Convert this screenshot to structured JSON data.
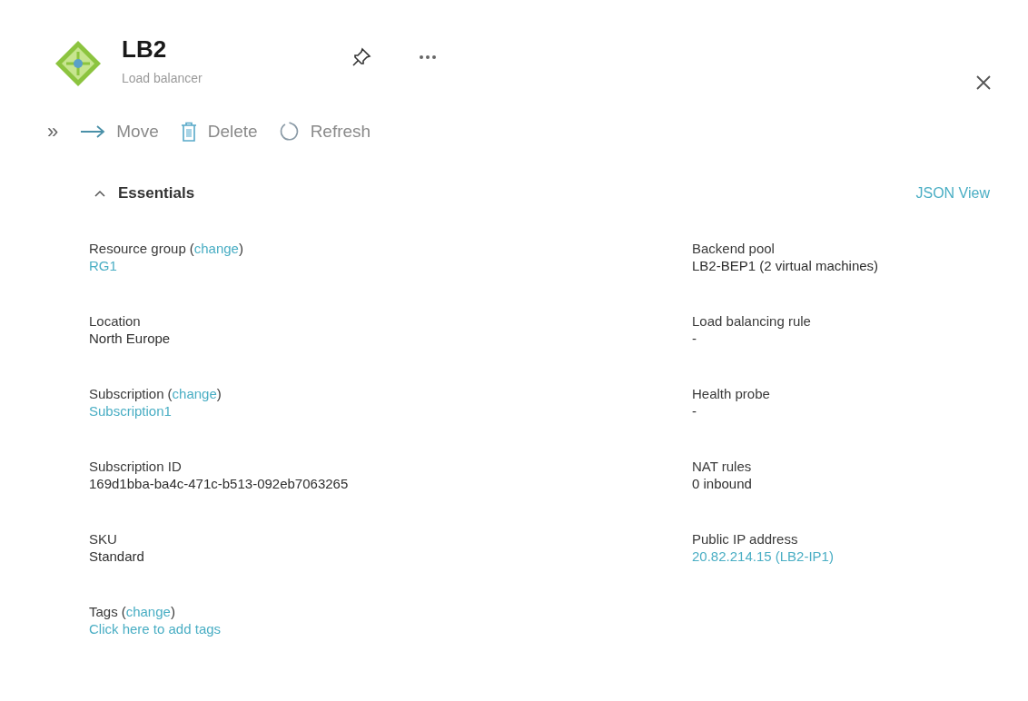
{
  "header": {
    "title": "LB2",
    "subtitle": "Load balancer"
  },
  "toolbar": [
    {
      "kind": "expand",
      "label": "»"
    },
    {
      "kind": "move",
      "label": "Move"
    },
    {
      "kind": "delete",
      "label": "Delete"
    },
    {
      "kind": "refresh",
      "label": "Refresh"
    }
  ],
  "essentials": {
    "title": "Essentials",
    "expanded": true,
    "json_view": "JSON View",
    "left": [
      {
        "label": "Resource group",
        "change": {
          "open": "(",
          "text": "change",
          "close": ")"
        },
        "value": "RG1",
        "kind": "link"
      },
      {
        "label": "Location",
        "value": "North Europe",
        "kind": "plain"
      },
      {
        "label": "Subscription",
        "change": {
          "open": "(",
          "text": "change",
          "close": ")"
        },
        "value": "Subscription1",
        "kind": "link"
      },
      {
        "label": "Subscription ID",
        "value": "169d1bba-ba4c-471c-b513-092eb7063265",
        "kind": "plain"
      },
      {
        "label": "SKU",
        "value": "Standard",
        "kind": "plain"
      },
      {
        "label": "Tags",
        "change": {
          "open": "(",
          "text": "change",
          "close": ")"
        },
        "value": "Click here to add tags",
        "kind": "link"
      }
    ],
    "right": [
      {
        "label": "Backend pool",
        "value": "LB2-BEP1 (2 virtual machines)",
        "kind": "plain"
      },
      {
        "label": "Load balancing rule",
        "value": "-",
        "kind": "plain"
      },
      {
        "label": "Health probe",
        "value": "-",
        "kind": "plain"
      },
      {
        "label": "NAT rules",
        "value": "0 inbound",
        "kind": "plain"
      },
      {
        "label": "Public IP address",
        "value": "20.82.214.15 (LB2-IP1)",
        "kind": "link"
      }
    ]
  }
}
